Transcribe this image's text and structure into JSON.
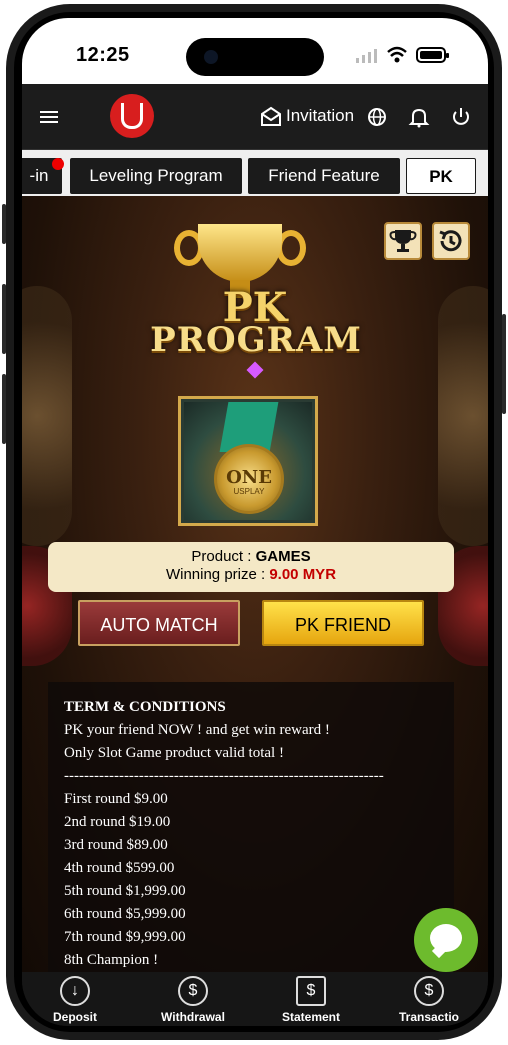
{
  "status_bar": {
    "time": "12:25"
  },
  "top_nav": {
    "invitation_label": "Invitation"
  },
  "tabs": [
    {
      "label": "-in",
      "active": false,
      "has_badge": true
    },
    {
      "label": "Leveling Program",
      "active": false
    },
    {
      "label": "Friend Feature",
      "active": false
    },
    {
      "label": "PK",
      "active": true
    }
  ],
  "banner": {
    "title_line1": "PK",
    "title_line2": "PROGRAM"
  },
  "product_image": {
    "medal_text": "ONE",
    "medal_subtext": "USPLAY"
  },
  "product": {
    "product_label": "Product : ",
    "product_value": "GAMES",
    "prize_label": "Winning prize : ",
    "prize_value": "9.00 MYR"
  },
  "actions": {
    "auto_match": "AUTO MATCH",
    "pk_friend": "PK FRIEND"
  },
  "terms": {
    "heading": "TERM & CONDITIONS",
    "lines": [
      "PK your friend NOW ! and get win reward !",
      "Only Slot Game product valid total !",
      "----------------------------------------------------------------",
      "First round $9.00",
      "2nd round $19.00",
      "3rd round $89.00",
      "4th round $599.00",
      "5th round $1,999.00",
      "6th round $5,999.00",
      "7th round $9,999.00",
      "8th Champion !"
    ]
  },
  "bottom_nav": [
    {
      "label": "Deposit",
      "icon": "deposit-icon"
    },
    {
      "label": "Withdrawal",
      "icon": "dollar-icon"
    },
    {
      "label": "Statement",
      "icon": "statement-icon"
    },
    {
      "label": "Transactio",
      "icon": "transaction-icon"
    }
  ],
  "colors": {
    "accent_red": "#d81e1e",
    "gold": "#f5d36a",
    "prize_red": "#c30000",
    "chat_green": "#6dbb2d"
  }
}
